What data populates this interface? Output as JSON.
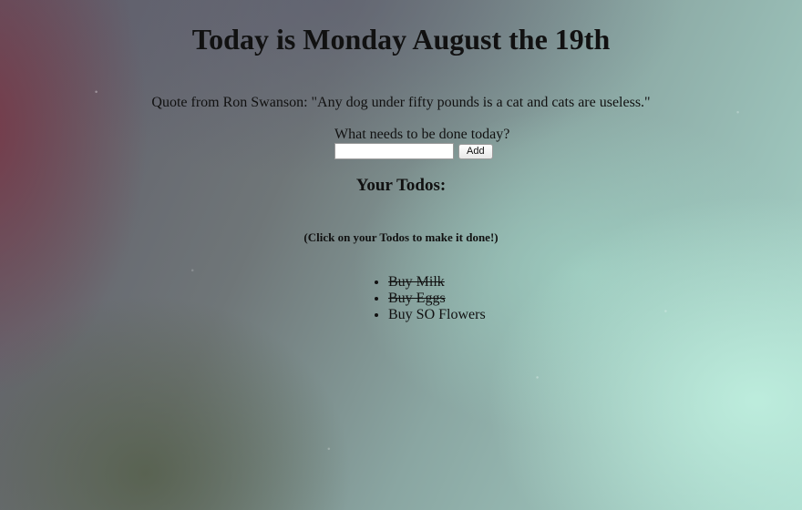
{
  "header": {
    "title": "Today is Monday August the 19th"
  },
  "quote": {
    "text": "Quote from Ron Swanson: \"Any dog under fifty pounds is a cat and cats are useless.\""
  },
  "form": {
    "prompt": "What needs to be done today?",
    "input_value": "",
    "add_label": "Add"
  },
  "todos": {
    "heading": "Your Todos:",
    "hint": "(Click on your Todos to make it done!)",
    "items": [
      {
        "label": "Buy Milk",
        "done": true
      },
      {
        "label": "Buy Eggs",
        "done": true
      },
      {
        "label": "Buy SO Flowers",
        "done": false
      }
    ]
  }
}
